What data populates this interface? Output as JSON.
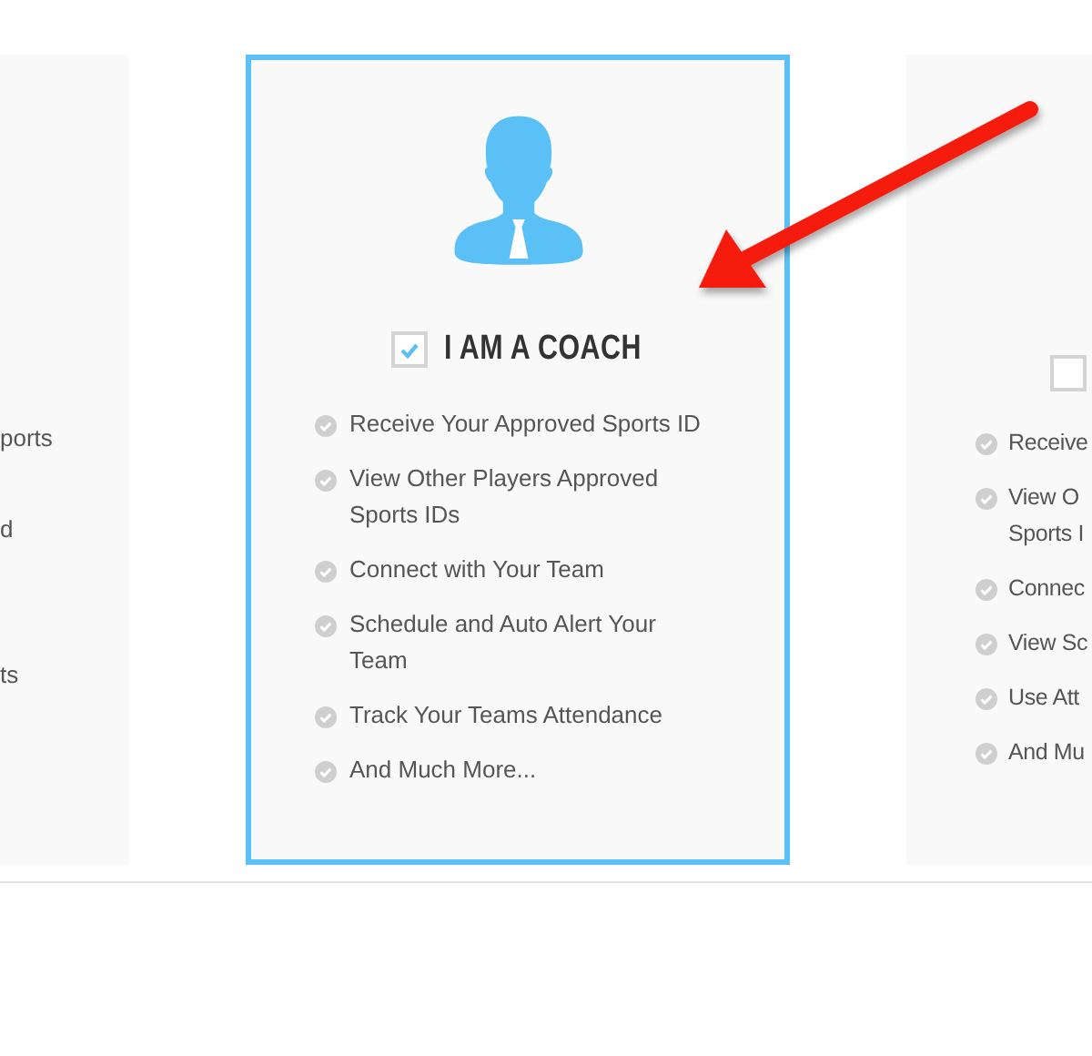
{
  "cards": [
    {
      "selected": false,
      "figure": false,
      "bullets": false,
      "features": [
        {
          "lines": [
            "ports"
          ]
        },
        {
          "lines": [
            "d"
          ]
        },
        {
          "lines": [
            "ts"
          ]
        }
      ]
    },
    {
      "selected": true,
      "figure": true,
      "bullets": true,
      "checked": true,
      "title": "I AM A COACH",
      "features": [
        {
          "lines": [
            "Receive Your Approved Sports ID"
          ]
        },
        {
          "lines": [
            "View Other Players Approved",
            "Sports IDs"
          ]
        },
        {
          "lines": [
            "Connect with Your Team"
          ]
        },
        {
          "lines": [
            "Schedule and Auto Alert Your",
            "Team"
          ]
        },
        {
          "lines": [
            "Track Your Teams Attendance"
          ]
        },
        {
          "lines": [
            "And Much More..."
          ]
        }
      ]
    },
    {
      "selected": false,
      "figure": false,
      "bullets": true,
      "checked": false,
      "features": [
        {
          "lines": [
            "Receive"
          ]
        },
        {
          "lines": [
            "View O",
            "Sports I"
          ]
        },
        {
          "lines": [
            "Connec"
          ]
        },
        {
          "lines": [
            "View Sc"
          ]
        },
        {
          "lines": [
            "Use Att"
          ]
        },
        {
          "lines": [
            "And Mu"
          ]
        }
      ]
    }
  ]
}
